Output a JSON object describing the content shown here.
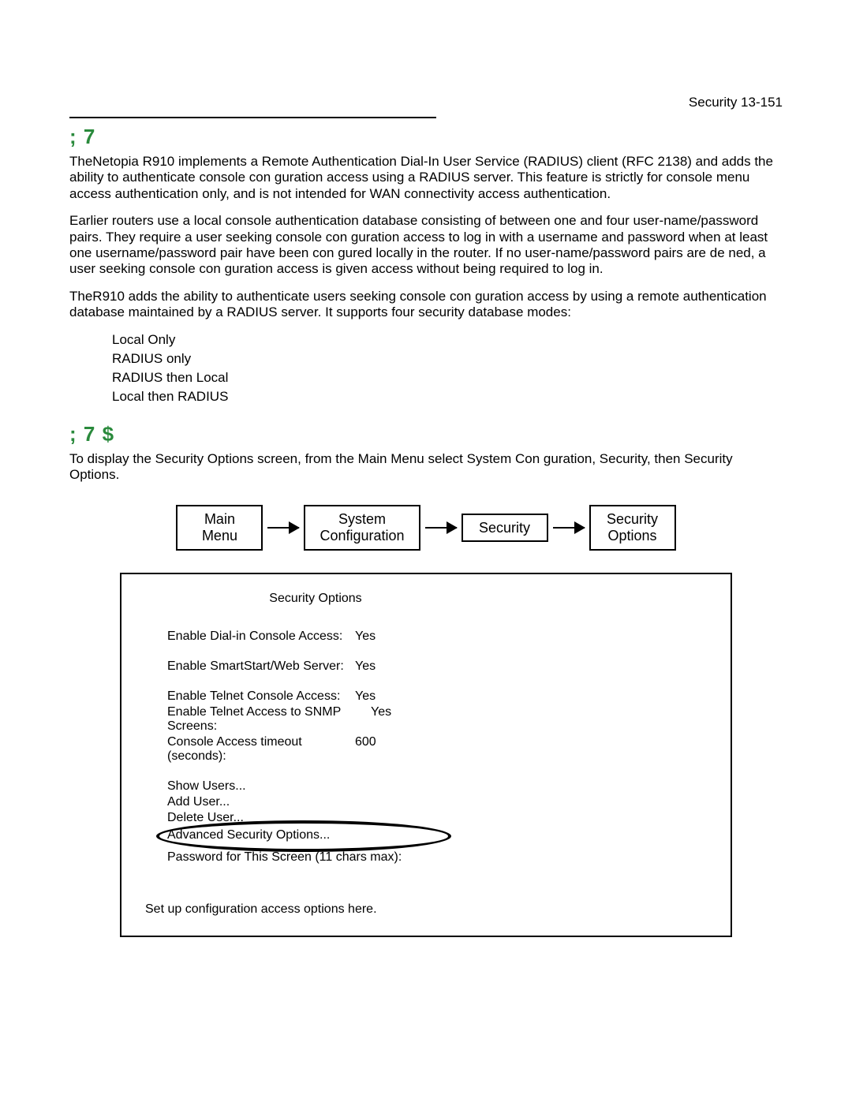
{
  "header": {
    "right": "Security   13-151"
  },
  "section1": {
    "title": ";   7",
    "p1": "TheNetopia R910 implements a Remote Authentication Dial-In User Service (RADIUS) client (RFC 2138) and adds the ability to authenticate console con guration access using a RADIUS server. This feature is strictly for console menu access authentication only, and is not intended for WAN connectivity access authentication.",
    "p2": "Earlier routers use a local console authentication database consisting of between one and four user-name/password pairs. They require a user seeking console con guration access to log in with a username and password when at least one username/password pair have been con gured locally in the router. If no user-name/password pairs are de ned, a user seeking console con guration access is given access without being required to log in.",
    "p3": "TheR910 adds the ability to authenticate users seeking console con guration access by using a remote authentication database maintained by a RADIUS server. It supports four security database modes:",
    "bullets": [
      "Local Only",
      "RADIUS only",
      "RADIUS then Local",
      "Local then RADIUS"
    ]
  },
  "section2": {
    "title": ";   7                    $",
    "p1": "To display the Security Options screen, from the Main Menu select System Con guration, Security, then Security Options."
  },
  "breadcrumb": {
    "b1": "Main\nMenu",
    "b2": "System\nConfiguration",
    "b3": "Security",
    "b4": "Security\nOptions"
  },
  "screen": {
    "title": "Security Options",
    "r1l": "Enable Dial-in Console Access:",
    "r1v": "Yes",
    "r2l": "Enable SmartStart/Web Server:",
    "r2v": "Yes",
    "r3l": "Enable Telnet Console Access:",
    "r3v": "Yes",
    "r4l": "Enable Telnet Access to SNMP Screens:",
    "r4v": "Yes",
    "r5l": "Console Access timeout (seconds):",
    "r5v": "600",
    "u1": "Show Users...",
    "u2": "Add User...",
    "u3": "Delete User...",
    "adv": "Advanced Security Options...",
    "pwd": "Password for This Screen (11 chars max):",
    "footer": "Set up configuration access options here."
  }
}
